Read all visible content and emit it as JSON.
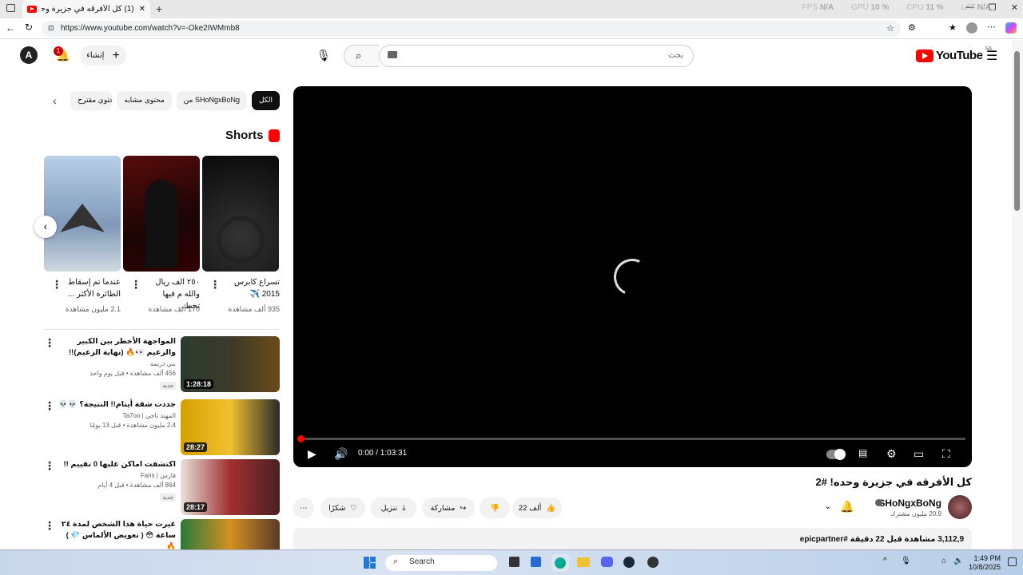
{
  "browser": {
    "tab_title": "(1) كل الأفرقه في جزيرة وحده! #2",
    "new_tab": "+",
    "url": "https://www.youtube.com/watch?v=-Oke2IWMmb8",
    "stats": [
      {
        "label": "FPS",
        "value": "N/A"
      },
      {
        "label": "GPU",
        "value": "10 %"
      },
      {
        "label": "CPU",
        "value": "11 %"
      },
      {
        "label": "LAT",
        "value": "N/A"
      }
    ]
  },
  "header": {
    "avatar_letter": "A",
    "notif_count": "1",
    "create_label": "إنشاء",
    "search_placeholder": "بحث",
    "logo_text": "YouTube",
    "logo_region": "SA"
  },
  "chips": [
    "الكل",
    "من SHoNgxBoNg",
    "محتوى مشابه",
    "محتوى مقترح"
  ],
  "shorts": {
    "heading": "Shorts",
    "items": [
      {
        "title": "تسراع كابرس 2015 ✈️",
        "views": "935 ألف مشاهدة"
      },
      {
        "title": "٢٥٠ الف ريال والله م فيها تخط...",
        "views": "170 ألف مشاهدة"
      },
      {
        "title": "عندما تم إسقاط الطائرة الأكثر ...",
        "views": "2.1 مليون مشاهدة"
      }
    ]
  },
  "videos": [
    {
      "title": "المواجهة الأخطر بين الكبير والزعيم 👀🔥 (نهاية الزعيم)!!",
      "channel": "بني دريمه",
      "meta": "456 ألف مشاهدة • قبل يوم واحد",
      "badge": "جديد",
      "duration": "1:28:18"
    },
    {
      "title": "جددت شقة أيتام!! النتيجة؟ 💀💀",
      "channel": "المهند ناجي | Ta7oo",
      "meta": "2.4 مليون مشاهدة • قبل 13 يومًا",
      "badge": "",
      "duration": "28:27"
    },
    {
      "title": "اكتشفت اماكن عليها 0 تقييم !!",
      "channel": "فارس | Faris",
      "meta": "864 ألف مشاهدة • قبل 4 أيام",
      "badge": "جديد",
      "duration": "28:17"
    },
    {
      "title": "غيرت حياة هذا الشخص لمدة ٢٤ ساعة 😳 ( تعويض الألماس 💎 ) 🔥",
      "channel": "",
      "meta": "",
      "badge": "",
      "duration": ""
    }
  ],
  "player": {
    "time": "0:00 / 1:03:31",
    "progress": 0.0
  },
  "video": {
    "title": "كل الأفرقه في جزيرة وحده! #2",
    "channel": "SHoNgxBoNg",
    "subs": "20.9 مليون مشترك",
    "likes": "22 ألف",
    "share": "مشاركة",
    "download": "تنزيل",
    "thanks": "شكرًا",
    "desc_meta": "3,112,9 مشاهدة  قبل 22 دقيقة  #epicpartner"
  },
  "taskbar": {
    "search": "Search",
    "time": "1:49 PM",
    "date": "10/8/2025"
  },
  "colors": {
    "accent": "#ff0000",
    "player_bg": "#000000"
  }
}
